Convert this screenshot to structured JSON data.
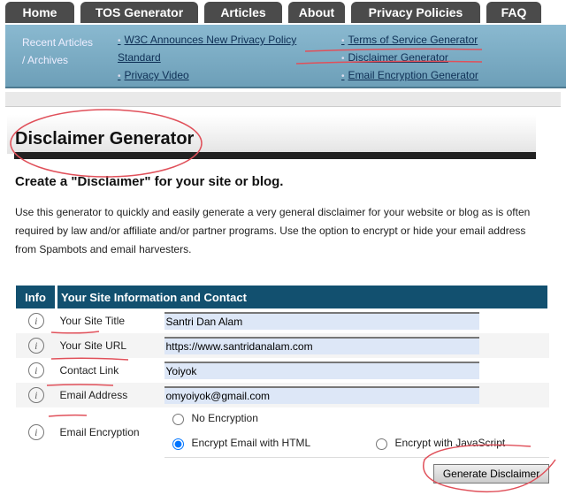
{
  "nav": {
    "tabs": [
      "Home",
      "TOS Generator",
      "Articles",
      "About",
      "Privacy Policies",
      "FAQ"
    ]
  },
  "panel": {
    "label_line1": "Recent Articles",
    "label_line2": "/ Archives",
    "links": [
      "W3C Announces New Privacy Policy",
      "Standard",
      "Privacy Video",
      "Terms of Service Generator",
      "Disclaimer Generator",
      "Email Encryption Generator"
    ]
  },
  "page": {
    "title": "Disclaimer Generator",
    "subtitle": "Create a \"Disclaimer\" for your site or blog.",
    "description": "Use this generator to quickly and easily generate a very general disclaimer for your website or blog as is often required by law and/or affiliate and/or partner programs. Use the option to encrypt or hide your email address from Spambots and email harvesters."
  },
  "form": {
    "col_info": "Info",
    "col_main": "Your Site Information and Contact",
    "info_icon": "i",
    "fields": [
      {
        "label": "Your Site Title",
        "value": "Santri Dan Alam"
      },
      {
        "label": "Your Site URL",
        "value": "https://www.santridanalam.com"
      },
      {
        "label": "Contact Link",
        "value": "Yoiyok"
      },
      {
        "label": "Email Address",
        "value": "omyoiyok@gmail.com"
      }
    ],
    "encryption_label": "Email Encryption",
    "options": [
      "No Encryption",
      "Encrypt Email with HTML",
      "Encrypt with JavaScript"
    ],
    "selected": "Encrypt Email with HTML",
    "submit": "Generate Disclaimer"
  },
  "colors": {
    "nav": "#4b4b4b",
    "panel": "#7fb0c8",
    "table_header": "#12506f",
    "annotation": "#e0505a"
  }
}
